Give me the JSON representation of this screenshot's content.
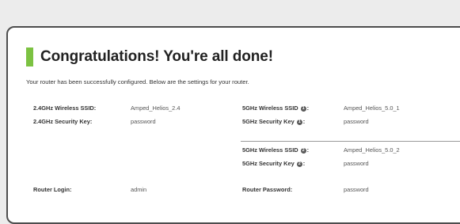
{
  "heading": {
    "title": "Congratulations! You're all done!",
    "accent_color": "#7cc242"
  },
  "intro": "Your router has been successfully configured. Below are the settings for your router.",
  "settings": {
    "wifi24_ssid_label": "2.4GHz Wireless SSID:",
    "wifi24_ssid_value": "Amped_Helios_2.4",
    "wifi24_key_label": "2.4GHz Security Key:",
    "wifi24_key_value": "password",
    "wifi5_1_ssid_label": "5GHz Wireless SSID",
    "wifi5_1_ssid_value": "Amped_Helios_5.0_1",
    "wifi5_1_key_label": "5GHz Security Key",
    "wifi5_1_key_value": "password",
    "wifi5_2_ssid_label": "5GHz Wireless SSID",
    "wifi5_2_ssid_value": "Amped_Helios_5.0_2",
    "wifi5_2_key_label": "5GHz Security Key",
    "wifi5_2_key_value": "password",
    "router_login_label": "Router Login:",
    "router_login_value": "admin",
    "router_password_label": "Router Password:",
    "router_password_value": "password",
    "info_icon_glyph": "1",
    "info_icon_glyph_2": "2",
    "colon": ":"
  }
}
